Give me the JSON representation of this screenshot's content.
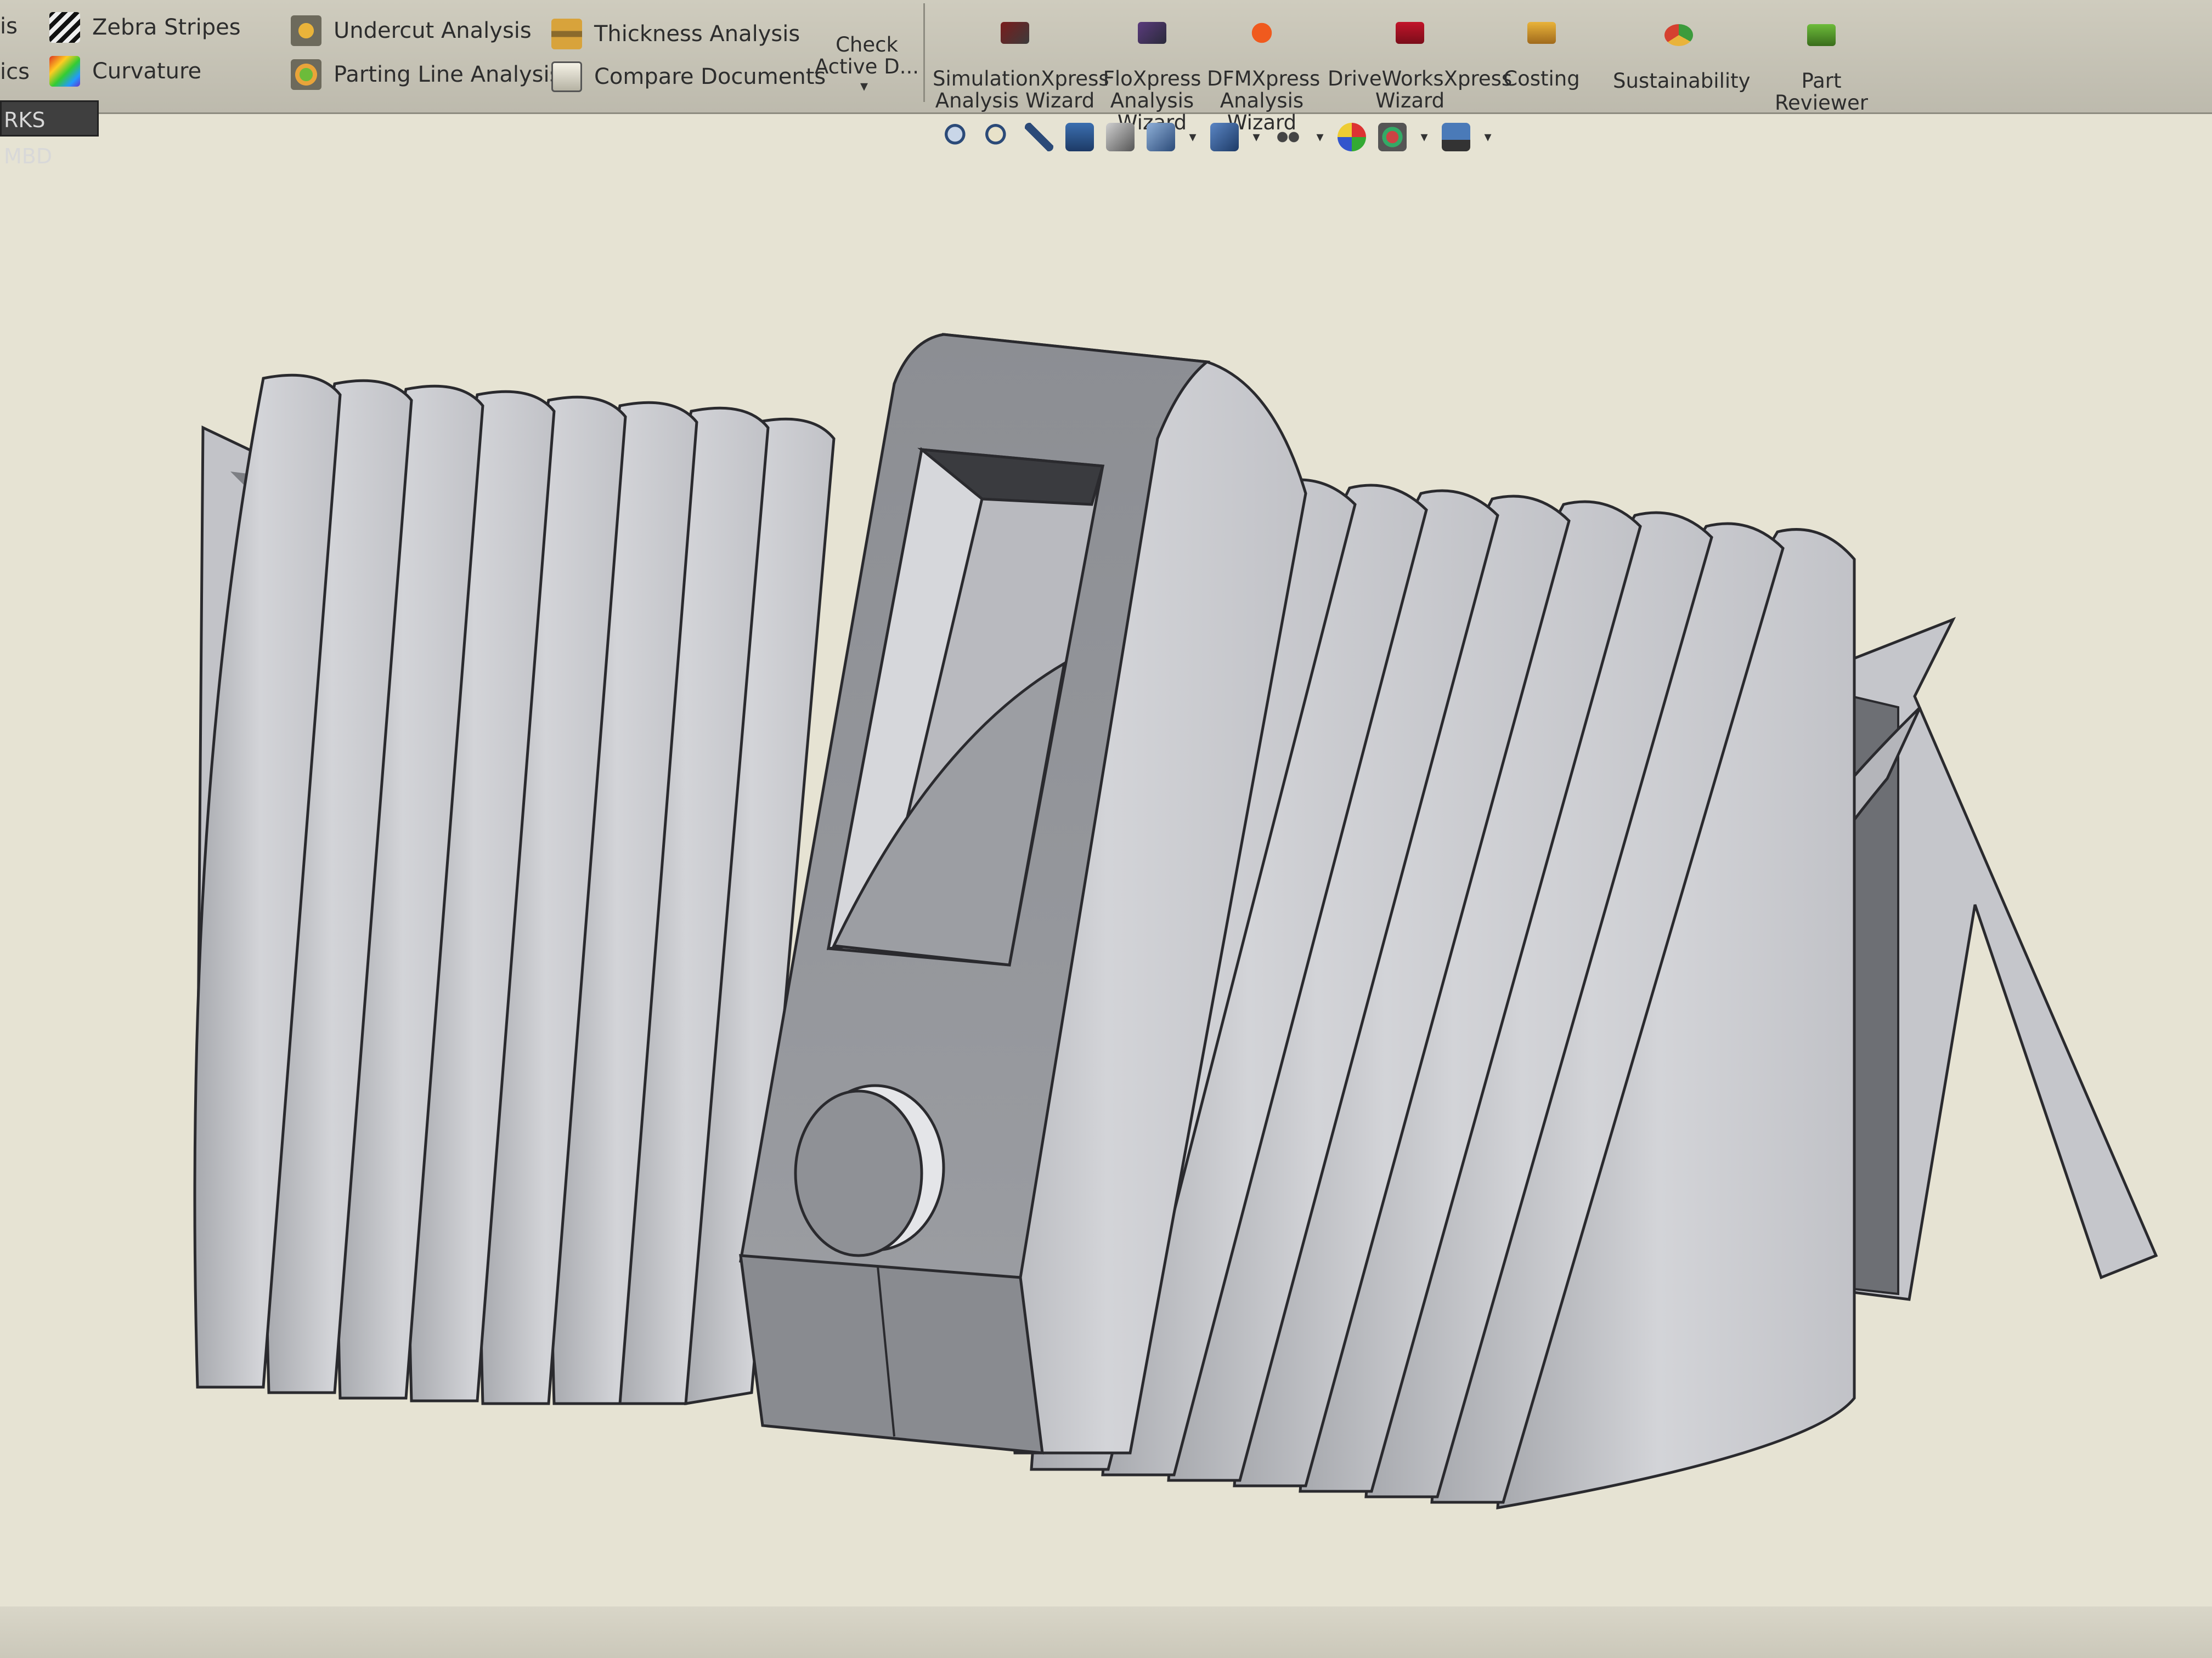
{
  "ribbon": {
    "left_labels": [
      "is",
      "ics"
    ],
    "small_tools": [
      {
        "label": "Zebra Stripes",
        "icon": "zebra-stripes-icon"
      },
      {
        "label": "Curvature",
        "icon": "curvature-icon"
      },
      {
        "label": "Undercut Analysis",
        "icon": "undercut-icon"
      },
      {
        "label": "Parting Line Analysis",
        "icon": "parting-line-icon"
      },
      {
        "label": "Thickness Analysis",
        "icon": "thickness-icon"
      },
      {
        "label": "Compare Documents",
        "icon": "compare-documents-icon"
      }
    ],
    "large_tools": [
      {
        "label": "Check\nActive D...",
        "icon": "check-active-document-icon"
      },
      {
        "label": "SimulationXpress\nAnalysis Wizard",
        "icon": "simulationxpress-icon"
      },
      {
        "label": "FloXpress\nAnalysis\nWizard",
        "icon": "floxpress-icon"
      },
      {
        "label": "DFMXpress\nAnalysis\nWizard",
        "icon": "dfmxpress-icon"
      },
      {
        "label": "DriveWorksXpress\nWizard",
        "icon": "driveworksxpress-icon"
      },
      {
        "label": "Costing",
        "icon": "costing-icon"
      },
      {
        "label": "Sustainability",
        "icon": "sustainability-icon"
      },
      {
        "label": "Part\nReviewer",
        "icon": "part-reviewer-icon"
      }
    ],
    "tab_label": "RKS MBD"
  },
  "view_toolbar": {
    "icons": [
      "zoom-to-fit-icon",
      "zoom-to-area-icon",
      "previous-view-icon",
      "section-view-icon",
      "dynamic-annotation-icon",
      "view-orientation-icon",
      "display-style-icon",
      "hide-show-items-icon",
      "edit-appearance-icon",
      "apply-scene-icon",
      "view-settings-icon"
    ]
  },
  "colors": {
    "ribbon_bg": "#c6c3b5",
    "viewport_bg": "#e6e3d3",
    "part_light": "#c9cacf",
    "part_mid": "#9fa1a6",
    "part_dark": "#6f7075",
    "edge": "#2a2a2e"
  }
}
